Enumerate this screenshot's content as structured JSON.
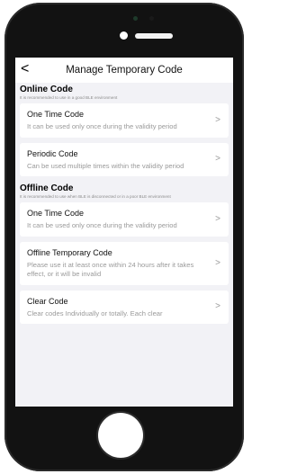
{
  "nav": {
    "back_glyph": "<",
    "title": "Manage Temporary Code"
  },
  "online": {
    "title": "Online Code",
    "subtitle": "It is recommended to use in a good BLE environment",
    "items": [
      {
        "title": "One Time Code",
        "desc": "It can be used only once during the validity period"
      },
      {
        "title": "Periodic Code",
        "desc": "Can be used multiple times within the validity period"
      }
    ]
  },
  "offline": {
    "title": "Offline Code",
    "subtitle": "It is recommended to use when BLE is disconnected or in a poor BLE environment",
    "items": [
      {
        "title": "One Time Code",
        "desc": "It can be used only once during the validity period"
      },
      {
        "title": "Offline Temporary Code",
        "desc": "Please use it at least once within 24 hours after it takes effect, or it will be invalid"
      },
      {
        "title": "Clear Code",
        "desc": "Clear codes Individually or totally. Each clear"
      }
    ]
  },
  "chevron_glyph": ">",
  "colors": {
    "background": "#f2f2f6",
    "card": "#ffffff",
    "muted_text": "#9a9a9a",
    "device_frame": "#121212"
  }
}
